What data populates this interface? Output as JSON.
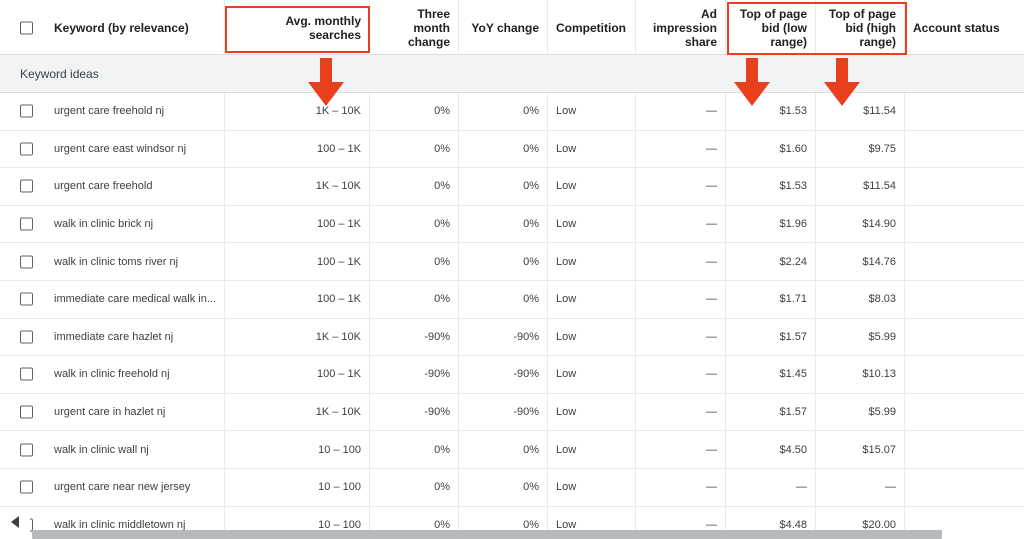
{
  "header": {
    "keyword": "Keyword (by relevance)",
    "avg_monthly": "Avg. monthly searches",
    "three_month": "Three month change",
    "yoy": "YoY change",
    "competition": "Competition",
    "ad_impression": "Ad impression share",
    "bid_low": "Top of page bid (low range)",
    "bid_high": "Top of page bid (high range)",
    "account_status": "Account status"
  },
  "section_label": "Keyword ideas",
  "rows": [
    {
      "keyword": "urgent care freehold nj",
      "avg": "1K – 10K",
      "three": "0%",
      "yoy": "0%",
      "comp": "Low",
      "share": "—",
      "low": "$1.53",
      "high": "$11.54"
    },
    {
      "keyword": "urgent care east windsor nj",
      "avg": "100 – 1K",
      "three": "0%",
      "yoy": "0%",
      "comp": "Low",
      "share": "—",
      "low": "$1.60",
      "high": "$9.75"
    },
    {
      "keyword": "urgent care freehold",
      "avg": "1K – 10K",
      "three": "0%",
      "yoy": "0%",
      "comp": "Low",
      "share": "—",
      "low": "$1.53",
      "high": "$11.54"
    },
    {
      "keyword": "walk in clinic brick nj",
      "avg": "100 – 1K",
      "three": "0%",
      "yoy": "0%",
      "comp": "Low",
      "share": "—",
      "low": "$1.96",
      "high": "$14.90"
    },
    {
      "keyword": "walk in clinic toms river nj",
      "avg": "100 – 1K",
      "three": "0%",
      "yoy": "0%",
      "comp": "Low",
      "share": "—",
      "low": "$2.24",
      "high": "$14.76"
    },
    {
      "keyword": "immediate care medical walk in...",
      "avg": "100 – 1K",
      "three": "0%",
      "yoy": "0%",
      "comp": "Low",
      "share": "—",
      "low": "$1.71",
      "high": "$8.03"
    },
    {
      "keyword": "immediate care hazlet nj",
      "avg": "1K – 10K",
      "three": "-90%",
      "yoy": "-90%",
      "comp": "Low",
      "share": "—",
      "low": "$1.57",
      "high": "$5.99"
    },
    {
      "keyword": "walk in clinic freehold nj",
      "avg": "100 – 1K",
      "three": "-90%",
      "yoy": "-90%",
      "comp": "Low",
      "share": "—",
      "low": "$1.45",
      "high": "$10.13"
    },
    {
      "keyword": "urgent care in hazlet nj",
      "avg": "1K – 10K",
      "three": "-90%",
      "yoy": "-90%",
      "comp": "Low",
      "share": "—",
      "low": "$1.57",
      "high": "$5.99"
    },
    {
      "keyword": "walk in clinic wall nj",
      "avg": "10 – 100",
      "three": "0%",
      "yoy": "0%",
      "comp": "Low",
      "share": "—",
      "low": "$4.50",
      "high": "$15.07"
    },
    {
      "keyword": "urgent care near new jersey",
      "avg": "10 – 100",
      "three": "0%",
      "yoy": "0%",
      "comp": "Low",
      "share": "—",
      "low": "—",
      "high": "—"
    },
    {
      "keyword": "walk in clinic middletown nj",
      "avg": "10 – 100",
      "three": "0%",
      "yoy": "0%",
      "comp": "Low",
      "share": "—",
      "low": "$4.48",
      "high": "$20.00"
    }
  ],
  "icons": {
    "checkbox": "checkbox-icon",
    "arrow": "arrow-down-icon",
    "scroll_left": "caret-left-icon"
  },
  "colors": {
    "highlight": "#e8401f",
    "arrow": "#e8401f"
  }
}
